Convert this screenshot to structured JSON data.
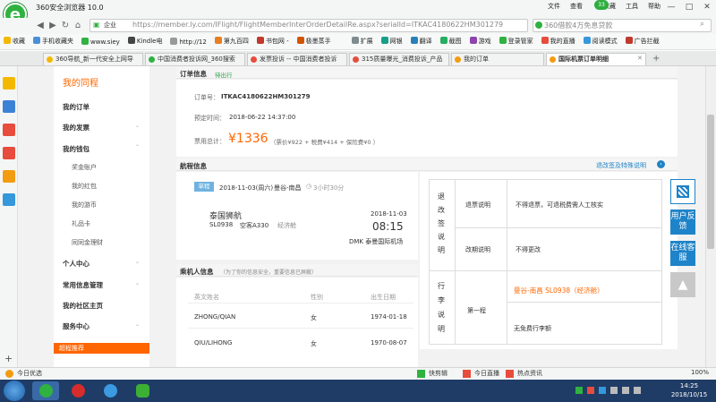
{
  "browser": {
    "title": "360安全浏览器 10.0",
    "menu": [
      "文件",
      "查看",
      "收藏",
      "工具",
      "帮助"
    ],
    "badge": "33",
    "addr_badge": "企业",
    "url": "https://member.ly.com/IFlight/FlightMemberInterOrderDetailRe.aspx?serialId=ITKAC4180622HM301279",
    "search": "360借款4万免息贷款",
    "bookmarks": [
      "收藏",
      "手机收藏夹",
      "www.siey",
      "Kindle电",
      "http://12",
      "第九百四",
      "书包网 -",
      "极墨蒸手",
      "扩展",
      "网银",
      "翻译",
      "截图",
      "游戏",
      "登录管家",
      "我的直播",
      "阅读模式",
      "广告拦截"
    ],
    "tabs": [
      "360导航_新一代安全上网导",
      "中国消费者投诉网_360搜索",
      "发票投诉 -- 中国消费者投诉",
      "315质量曝光_消费投诉_产品",
      "我的订单",
      "国际机票订单明细"
    ],
    "win_controls": {
      "restore": "⬜",
      "minimize": "—",
      "maximize": "□",
      "close": "✕"
    },
    "right_side_text": "4",
    "status": [
      "今日优选",
      "快剪辑",
      "今日直播",
      "热点资讯"
    ],
    "zoom": "100%",
    "clock_time": "14:25",
    "clock_date": "2018/10/15"
  },
  "sidebar": {
    "title": "我的同程",
    "items": [
      {
        "label": "我的订单",
        "type": "head"
      },
      {
        "label": "我的发票",
        "type": "head",
        "chev": "⌄"
      },
      {
        "label": "我的钱包",
        "type": "head",
        "chev": "⌃"
      },
      {
        "label": "奖金账户",
        "type": "sub"
      },
      {
        "label": "我的红包",
        "type": "sub"
      },
      {
        "label": "我的游币",
        "type": "sub"
      },
      {
        "label": "礼品卡",
        "type": "sub"
      },
      {
        "label": "同同金理财",
        "type": "sub"
      },
      {
        "label": "个人中心",
        "type": "head",
        "chev": "⌄"
      },
      {
        "label": "常用信息管理",
        "type": "head",
        "chev": "⌄"
      },
      {
        "label": "我的社区主页",
        "type": "head"
      },
      {
        "label": "服务中心",
        "type": "head",
        "chev": "⌄"
      }
    ],
    "promo": "超程推荐",
    "bottom": [
      "...",
      "..."
    ]
  },
  "order": {
    "section": "订单信息",
    "status": "待出行",
    "no_label": "订单号：",
    "no": "ITKAC4180622HM301279",
    "time_label": "预定时间：",
    "time": "2018-06-22 14:37:00",
    "total_label": "票用总计：",
    "total": "¥1336",
    "breakdown": "（票价¥922 + 税费¥414 + 保险费¥0 ）"
  },
  "flight": {
    "section": "航程信息",
    "rules_link": "退改签及特殊说明",
    "tag": "单程",
    "date": "2018-11-03(周六)",
    "route": "曼谷-南昌",
    "duration": "3小时30分",
    "airline": "泰国狮航",
    "flight_no": "SL0938",
    "aircraft": "空客A330",
    "cabin": "经济舱",
    "dep_date": "2018-11-03",
    "dep_time": "08:15",
    "dep_airport": "DMK 泰曼国际机场"
  },
  "rules": {
    "refund_vertical": "退改签说明",
    "refund_label": "退票说明",
    "refund_text": "不得退票，可退税费需人工核实",
    "change_label": "改期说明",
    "change_text": "不得更改",
    "baggage_vertical": "行李说明",
    "leg_label": "第一程",
    "leg_title": "曼谷-南昌  SL0938（经济舱）",
    "leg_text": "无免费行李额"
  },
  "passengers": {
    "section": "乘机人信息",
    "note": "（为了你的信息安全，重要信息已屏蔽）",
    "headers": [
      "英文姓名",
      "性别",
      "出生日期"
    ],
    "rows": [
      [
        "ZHONG/QIAN",
        "女",
        "1974-01-18"
      ],
      [
        "QIU/LIHONG",
        "女",
        "1970-08-07"
      ]
    ]
  },
  "chat": {
    "feedback": "用户反馈",
    "service": "在线客服",
    "top_arrow": "▲"
  }
}
